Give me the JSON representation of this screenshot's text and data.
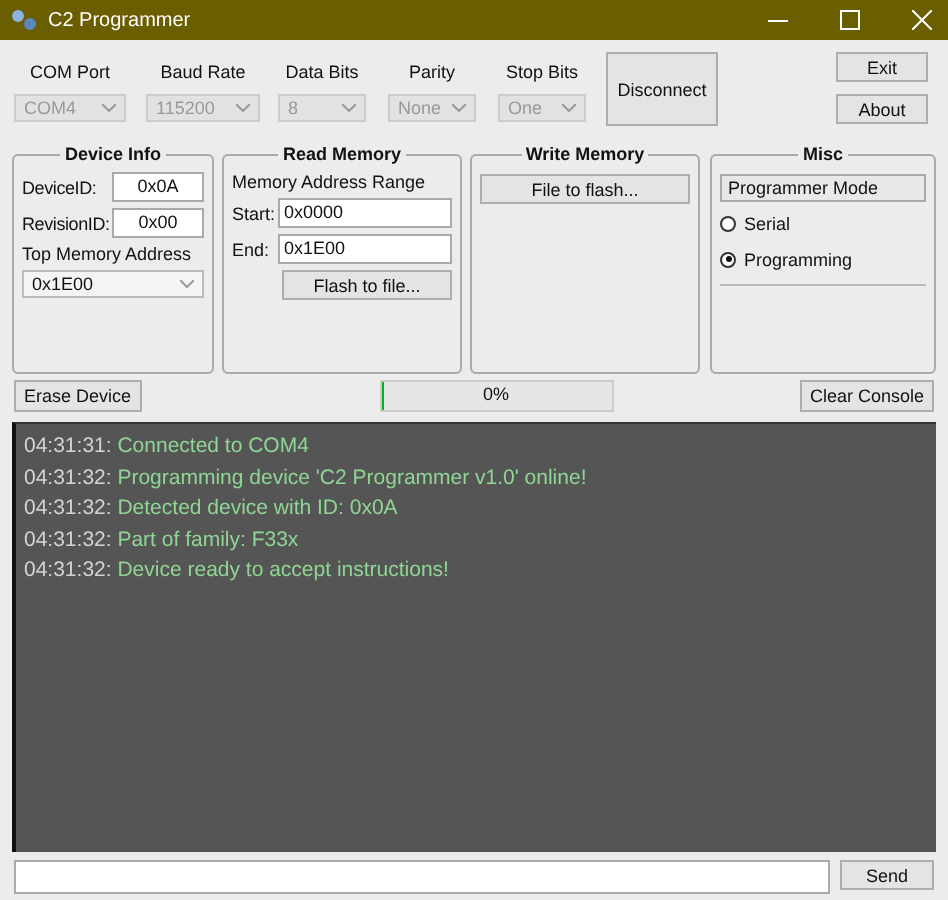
{
  "window": {
    "title": "C2 Programmer"
  },
  "serial": [
    {
      "label": "COM Port",
      "value": "COM4",
      "disabled": true
    },
    {
      "label": "Baud Rate",
      "value": "115200",
      "disabled": true
    },
    {
      "label": "Data Bits",
      "value": "8",
      "disabled": true
    },
    {
      "label": "Parity",
      "value": "None",
      "disabled": true
    },
    {
      "label": "Stop Bits",
      "value": "One",
      "disabled": true
    }
  ],
  "connect_button": "Disconnect",
  "exit_button": "Exit",
  "about_button": "About",
  "device_info": {
    "title": "Device Info",
    "device_id_label": "DeviceID:",
    "device_id": "0x0A",
    "revision_id_label": "RevisionID:",
    "revision_id": "0x00",
    "top_memory_label": "Top Memory Address",
    "top_memory": "0x1E00"
  },
  "read_memory": {
    "title": "Read Memory",
    "range_label": "Memory Address Range",
    "start_label": "Start:",
    "start": "0x0000",
    "end_label": "End:",
    "end": "0x1E00",
    "button": "Flash to file..."
  },
  "write_memory": {
    "title": "Write Memory",
    "button": "File to flash..."
  },
  "misc": {
    "title": "Misc",
    "mode_label": "Programmer Mode",
    "modes": [
      {
        "label": "Serial",
        "selected": false
      },
      {
        "label": "Programming",
        "selected": true
      }
    ]
  },
  "erase_button": "Erase Device",
  "progress": {
    "level": 0,
    "text": "0%"
  },
  "clear_button": "Clear Console",
  "console": [
    {
      "time": "04:31:31:",
      "message": "Connected to COM4"
    },
    {
      "time": "04:31:32:",
      "message": "Programming device 'C2 Programmer v1.0' online!"
    },
    {
      "time": "04:31:32:",
      "message": "Detected device with ID: 0x0A"
    },
    {
      "time": "04:31:32:",
      "message": "Part of family: F33x"
    },
    {
      "time": "04:31:32:",
      "message": "Device ready to accept instructions!"
    }
  ],
  "send_button": "Send"
}
